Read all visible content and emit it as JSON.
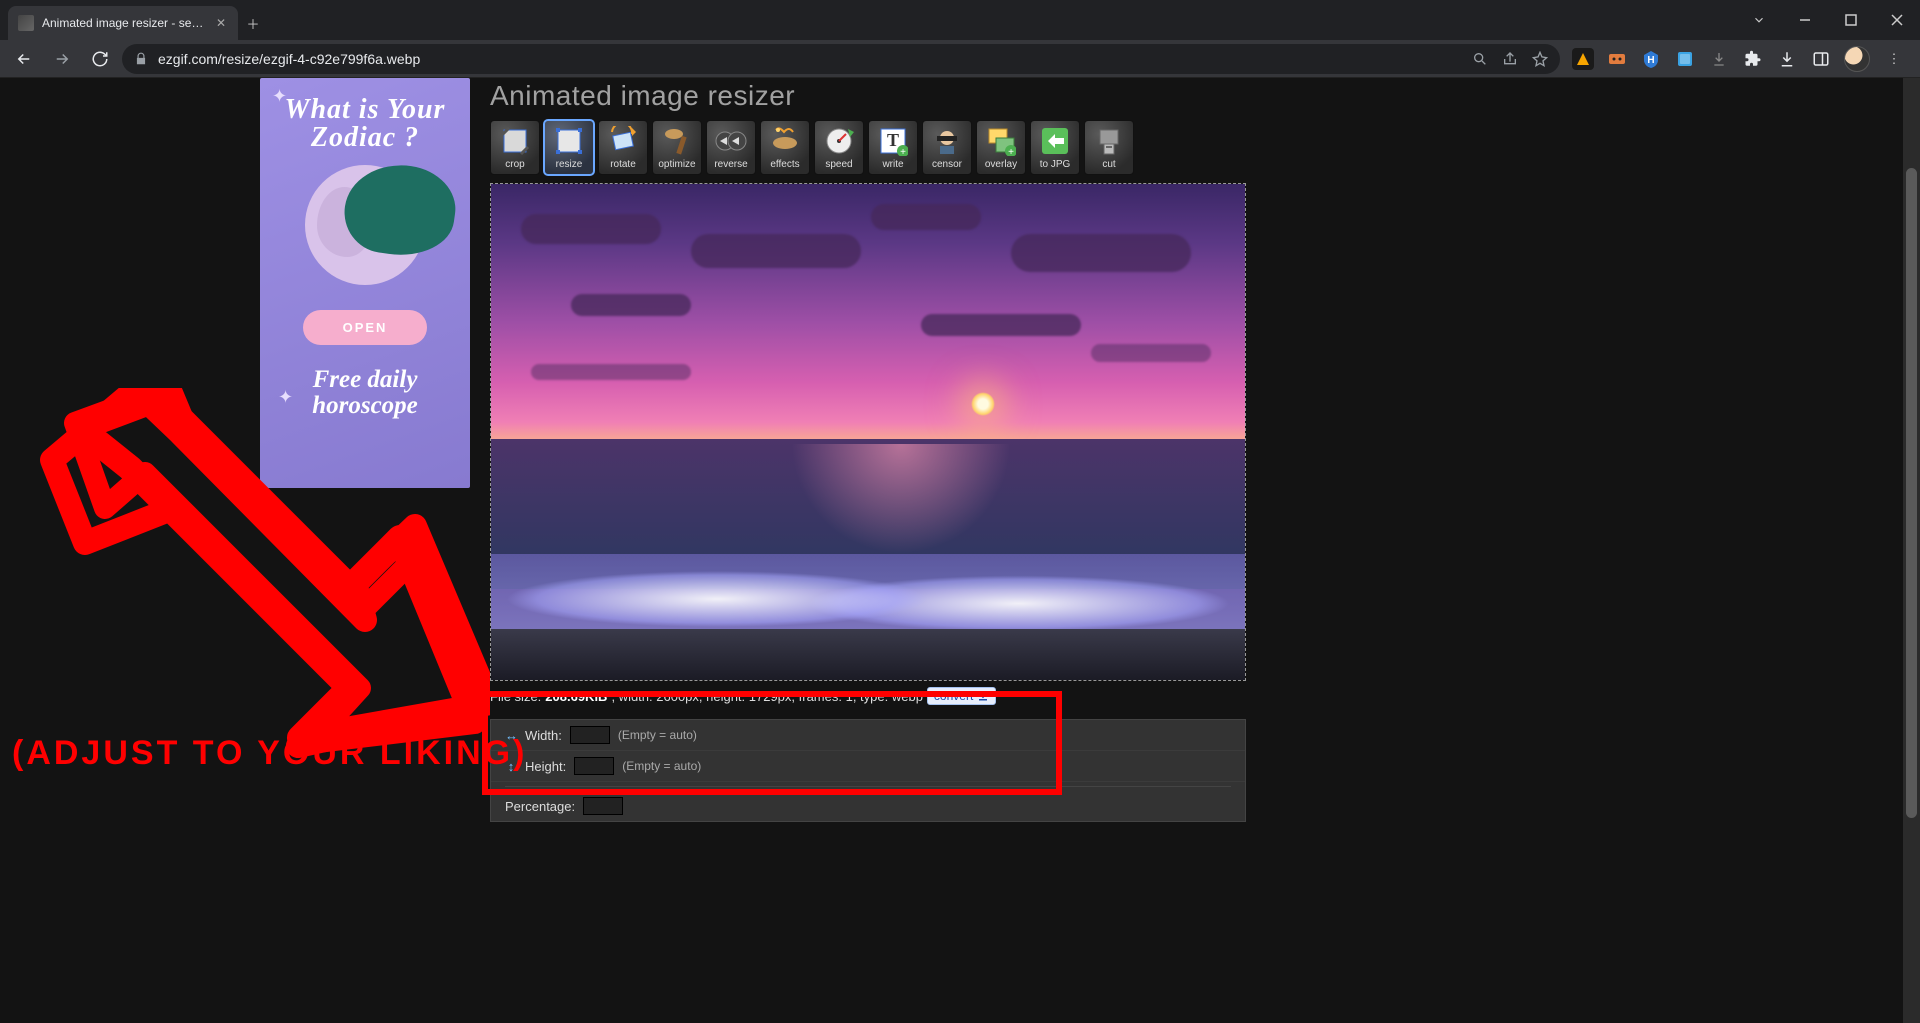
{
  "browser": {
    "tab_title": "Animated image resizer - sea.wel",
    "url": "ezgif.com/resize/ezgif-4-c92e799f6a.webp"
  },
  "ad": {
    "headline": "What is Your Zodiac ?",
    "cta": "OPEN",
    "sub": "Free daily horoscope"
  },
  "page": {
    "title": "Animated image resizer",
    "tools": [
      {
        "id": "crop",
        "label": "crop"
      },
      {
        "id": "resize",
        "label": "resize"
      },
      {
        "id": "rotate",
        "label": "rotate"
      },
      {
        "id": "optimize",
        "label": "optimize"
      },
      {
        "id": "reverse",
        "label": "reverse"
      },
      {
        "id": "effects",
        "label": "effects"
      },
      {
        "id": "speed",
        "label": "speed"
      },
      {
        "id": "write",
        "label": "write"
      },
      {
        "id": "censor",
        "label": "censor"
      },
      {
        "id": "overlay",
        "label": "overlay"
      },
      {
        "id": "tojpg",
        "label": "to JPG"
      },
      {
        "id": "cut",
        "label": "cut"
      }
    ],
    "meta": {
      "prefix": "File size: ",
      "size": "208.69KiB",
      "rest": ", width: 2600px, height: 1729px, frames: 1, type: webp",
      "convert": "convert"
    },
    "form": {
      "width_label": "Width:",
      "height_label": "Height:",
      "hint": "(Empty = auto)",
      "percentage_label": "Percentage:",
      "width_value": "",
      "height_value": "",
      "percentage_value": ""
    }
  },
  "annotation": {
    "text": "(ADJUST TO YOUR LIKING)"
  }
}
